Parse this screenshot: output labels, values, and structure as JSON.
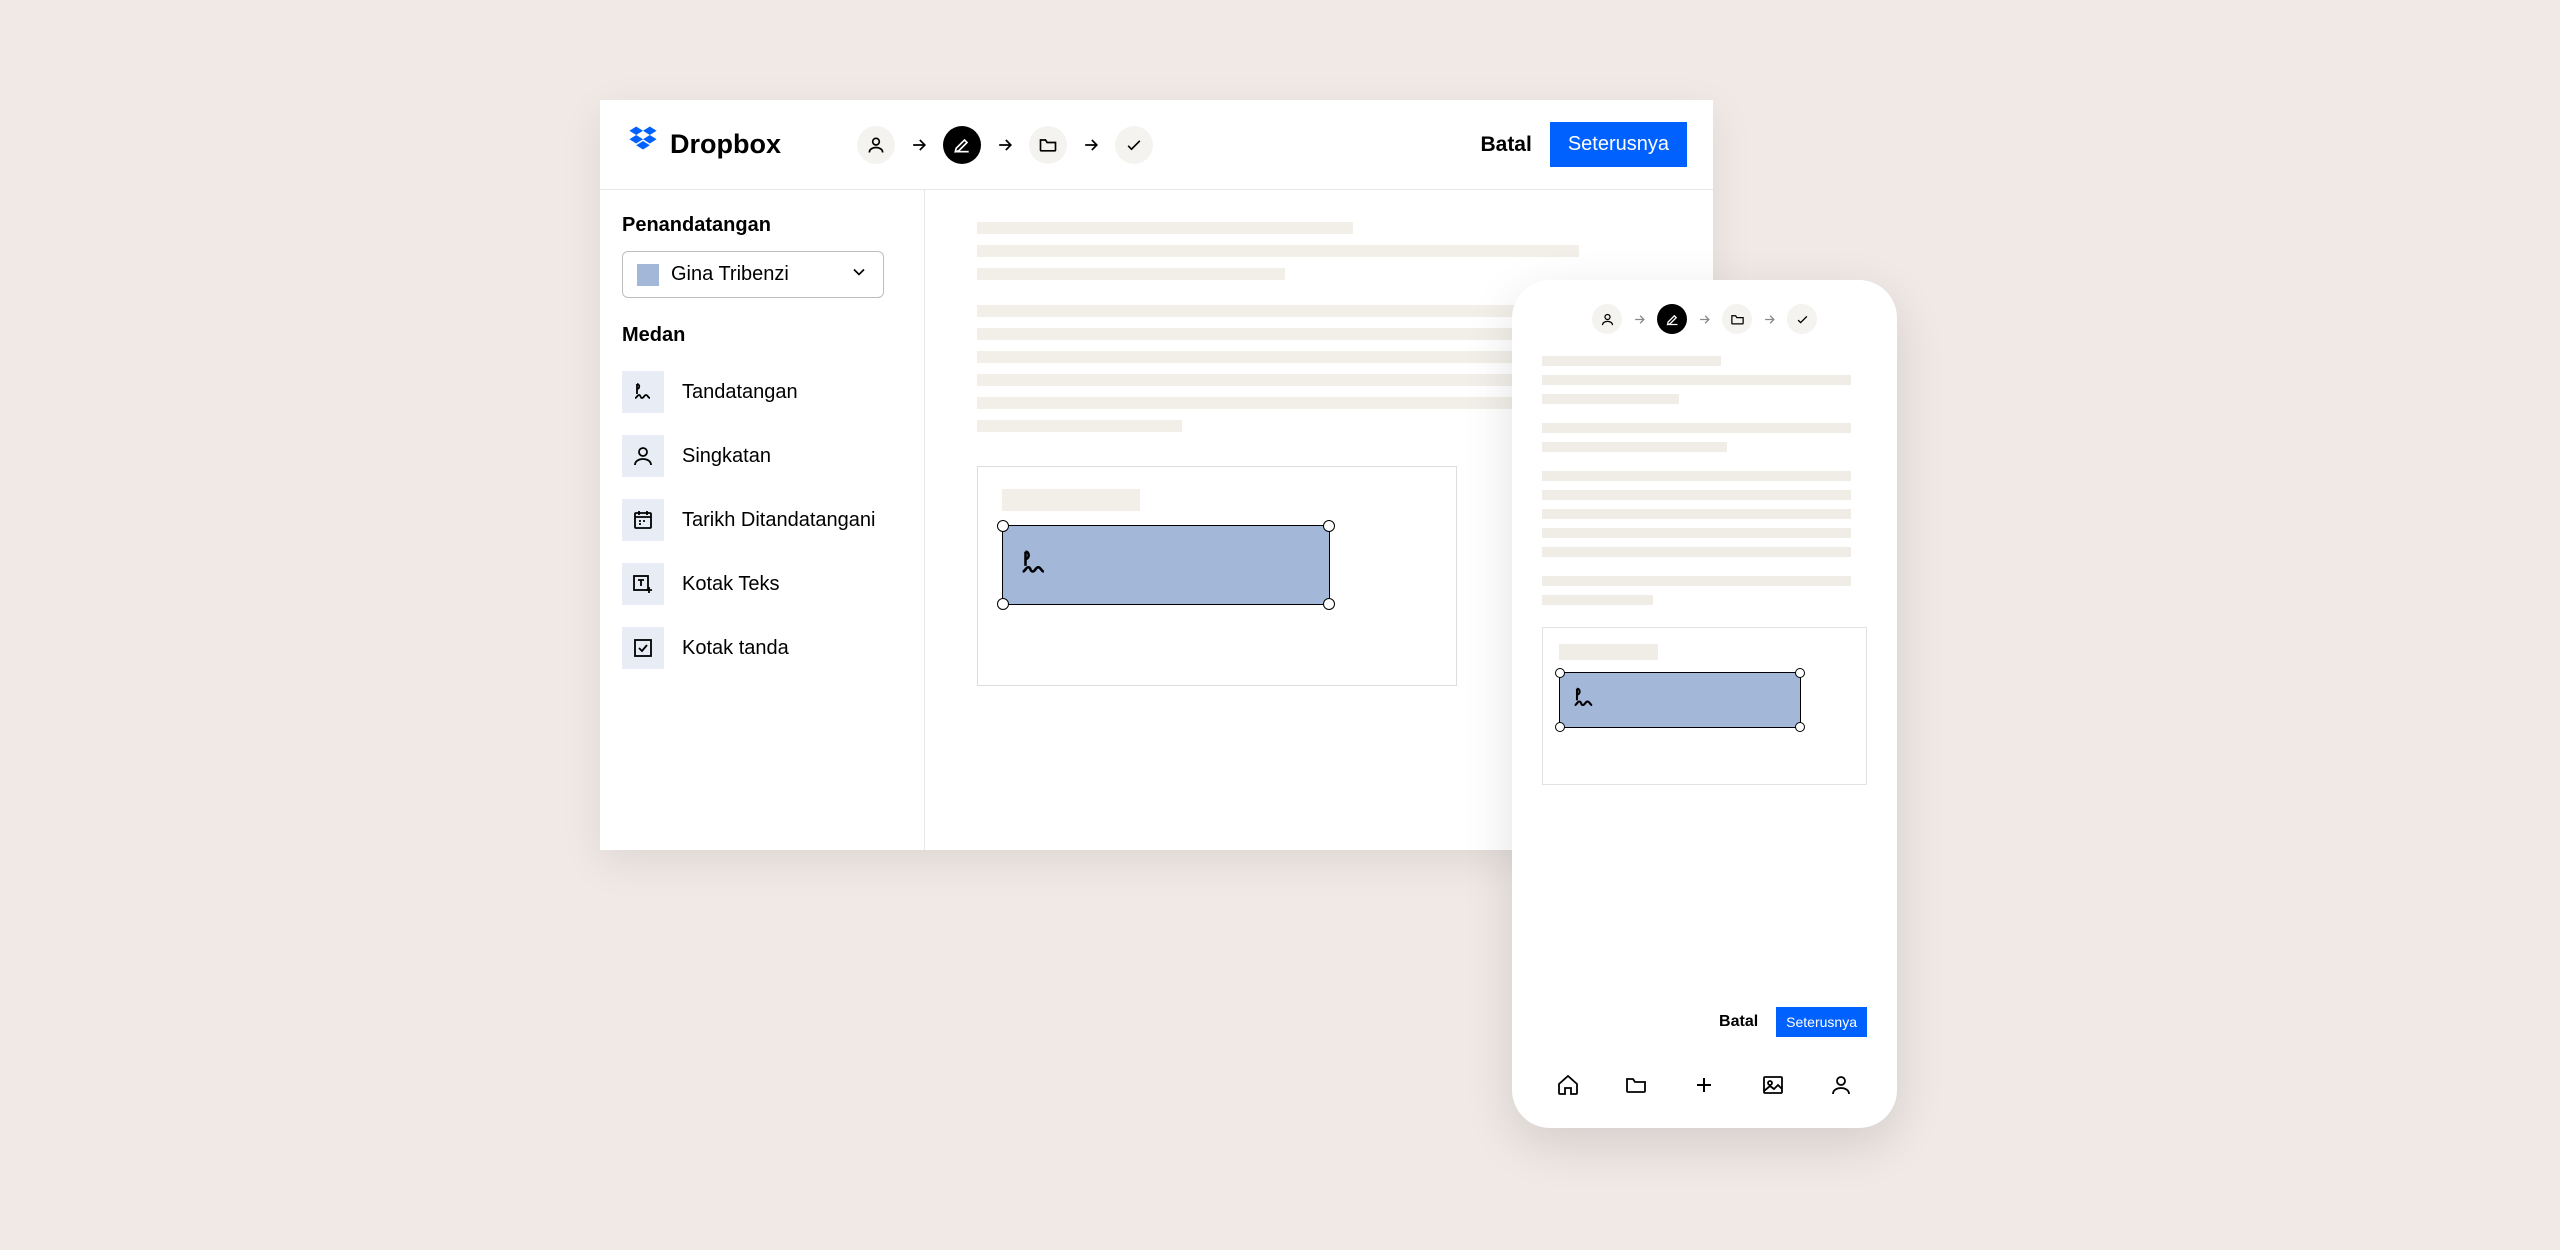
{
  "brand": {
    "name": "Dropbox"
  },
  "topbar": {
    "cancel_label": "Batal",
    "next_label": "Seterusnya"
  },
  "sidebar": {
    "signers_heading": "Penandatangan",
    "signer_selected": "Gina Tribenzi",
    "fields_heading": "Medan",
    "fields": [
      {
        "label": "Tandatangan"
      },
      {
        "label": "Singkatan"
      },
      {
        "label": "Tarikh Ditandatangani"
      },
      {
        "label": "Kotak Teks"
      },
      {
        "label": "Kotak tanda"
      }
    ]
  },
  "mobile": {
    "cancel_label": "Batal",
    "next_label": "Seterusnya"
  }
}
